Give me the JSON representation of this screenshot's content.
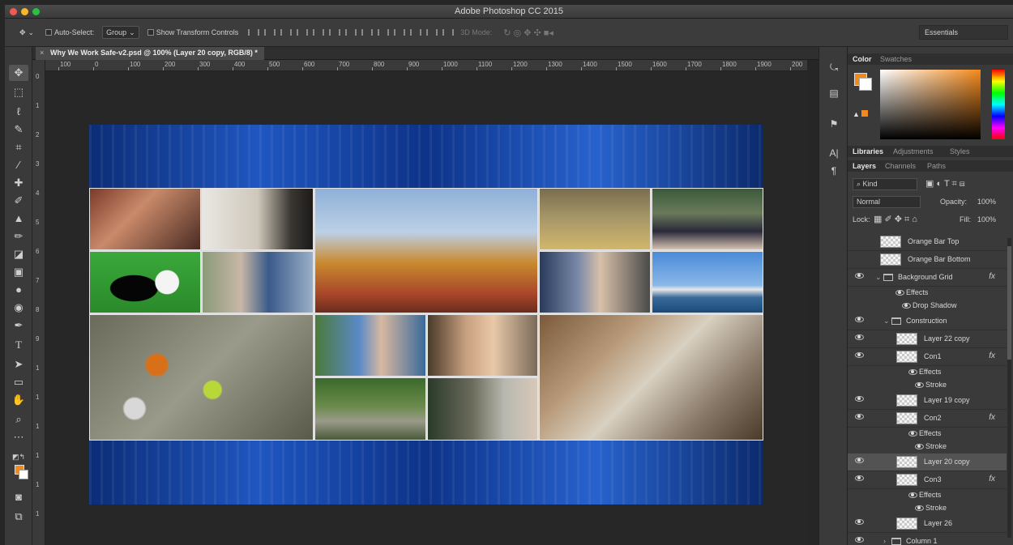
{
  "app": {
    "title": "Adobe Photoshop CC 2015"
  },
  "options_bar": {
    "auto_select_label": "Auto-Select:",
    "auto_select_value": "Group",
    "show_transform_label": "Show Transform Controls",
    "mode_3d_label": "3D Mode:",
    "workspace": "Essentials"
  },
  "document": {
    "tab_label": "Why We Work Safe-v2.psd @ 100% (Layer 20 copy, RGB/8) *",
    "ruler_labels": [
      "100",
      "0",
      "100",
      "200",
      "300",
      "400",
      "500",
      "600",
      "700",
      "800",
      "900",
      "1000",
      "1100",
      "1200",
      "1300",
      "1400",
      "1500",
      "1600",
      "1700",
      "1800",
      "1900",
      "200"
    ],
    "vruler_labels": [
      "0",
      "1",
      "2",
      "3",
      "4",
      "5",
      "6",
      "7",
      "8",
      "9",
      "1",
      "1",
      "1",
      "1",
      "1",
      "1"
    ]
  },
  "color_panel": {
    "tabs": [
      "Color",
      "Swatches"
    ],
    "foreground": "#f08a1c",
    "background": "#ffffff"
  },
  "library_tabs": [
    "Libraries",
    "Adjustments",
    "Styles"
  ],
  "layers_panel": {
    "tabs": [
      "Layers",
      "Channels",
      "Paths"
    ],
    "filter_kind": "Kind",
    "blend_mode": "Normal",
    "opacity_label": "Opacity:",
    "opacity_value": "100%",
    "lock_label": "Lock:",
    "fill_label": "Fill:",
    "fill_value": "100%",
    "layers": [
      {
        "name": "Orange Bar Top",
        "type": "layer",
        "indent": 0
      },
      {
        "name": "Orange Bar Bottom",
        "type": "layer",
        "indent": 0
      },
      {
        "name": "Background Grid",
        "type": "group",
        "indent": 0,
        "fx": "fx"
      },
      {
        "name": "Effects",
        "type": "effects",
        "indent": 1
      },
      {
        "name": "Drop Shadow",
        "type": "effect",
        "indent": 2
      },
      {
        "name": "Construction",
        "type": "group",
        "indent": 1
      },
      {
        "name": "Layer 22 copy",
        "type": "layer",
        "indent": 2
      },
      {
        "name": "Con1",
        "type": "layer",
        "indent": 2,
        "fx": "fx"
      },
      {
        "name": "Effects",
        "type": "effects",
        "indent": 3
      },
      {
        "name": "Stroke",
        "type": "effect",
        "indent": 4
      },
      {
        "name": "Layer 19 copy",
        "type": "layer",
        "indent": 2
      },
      {
        "name": "Con2",
        "type": "layer",
        "indent": 2,
        "fx": "fx"
      },
      {
        "name": "Effects",
        "type": "effects",
        "indent": 3
      },
      {
        "name": "Stroke",
        "type": "effect",
        "indent": 4
      },
      {
        "name": "Layer 20 copy",
        "type": "layer",
        "indent": 2,
        "selected": true
      },
      {
        "name": "Con3",
        "type": "layer",
        "indent": 2,
        "fx": "fx"
      },
      {
        "name": "Effects",
        "type": "effects",
        "indent": 3
      },
      {
        "name": "Stroke",
        "type": "effect",
        "indent": 4
      },
      {
        "name": "Layer 26",
        "type": "layer",
        "indent": 2
      },
      {
        "name": "Column 1",
        "type": "group",
        "indent": 1,
        "collapsed": true
      }
    ]
  }
}
